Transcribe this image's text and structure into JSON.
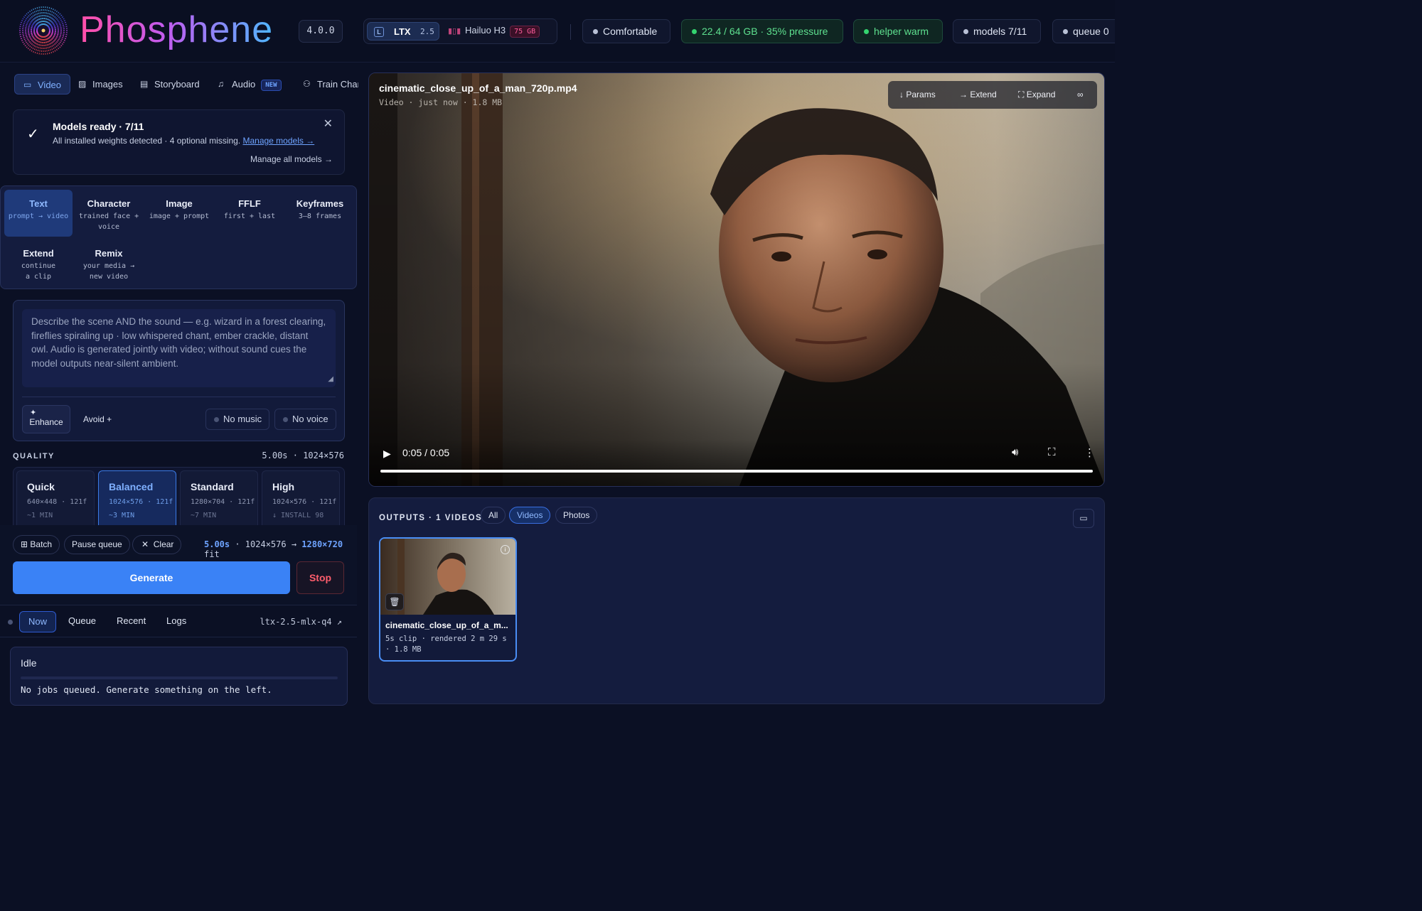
{
  "header": {
    "brand": "Phosphene",
    "version": "4.0.0",
    "engines": [
      {
        "name": "LTX",
        "version": "2.5",
        "active": true
      },
      {
        "name": "Hailuo H3",
        "badge": "75 GB",
        "active": false
      }
    ],
    "status_pills": [
      {
        "label": "Comfortable",
        "state": "neutral"
      },
      {
        "label": "22.4 / 64 GB · 35% pressure",
        "state": "ok"
      },
      {
        "label": "helper warm",
        "state": "ok"
      },
      {
        "label": "models 7/11",
        "state": "neutral"
      },
      {
        "label": "queue 0",
        "state": "neutral"
      }
    ]
  },
  "nav": {
    "tabs": [
      {
        "label": "Video",
        "icon": "video-icon",
        "active": true
      },
      {
        "label": "Images",
        "icon": "image-icon"
      },
      {
        "label": "Storyboard",
        "icon": "storyboard-icon"
      },
      {
        "label": "Audio",
        "icon": "music-note-icon",
        "badge": "NEW"
      },
      {
        "label": "Train Char",
        "icon": "user-icon"
      }
    ]
  },
  "notice": {
    "title": "Models ready · 7/11",
    "text": "All installed weights detected · 4 optional missing.",
    "link": "Manage models →",
    "footer_link": "Manage all models →"
  },
  "modes": [
    {
      "title": "Text",
      "sub": "prompt → video",
      "active": true
    },
    {
      "title": "Character",
      "sub": "trained face + voice"
    },
    {
      "title": "Image",
      "sub": "image + prompt"
    },
    {
      "title": "FFLF",
      "sub": "first + last"
    },
    {
      "title": "Keyframes",
      "sub": "3–8 frames"
    },
    {
      "title": "Extend",
      "sub": "continue a clip"
    },
    {
      "title": "Remix",
      "sub": "your media → new video"
    }
  ],
  "prompt": {
    "placeholder": "Describe the scene AND the sound — e.g. wizard in a forest clearing, fireflies spiraling up · low whispered chant, ember crackle, distant owl. Audio is generated jointly with video; without sound cues the model outputs near-silent ambient.",
    "enhance_label": "Enhance",
    "avoid_label": "Avoid +",
    "music_label": "No music",
    "voice_label": "No voice"
  },
  "quality": {
    "label": "QUALITY",
    "summary": "5.00s · 1024×576",
    "options": [
      {
        "name": "Quick",
        "spec": "640×448 · 121f",
        "time": "~1 MIN"
      },
      {
        "name": "Balanced",
        "spec": "1024×576 · 121f",
        "time": "~3 MIN",
        "active": true
      },
      {
        "name": "Standard",
        "spec": "1280×704 · 121f",
        "time": "~7 MIN"
      },
      {
        "name": "High",
        "spec": "1024×576 · 121f",
        "time": "↓ INSTALL 98"
      }
    ]
  },
  "actions": {
    "batch": "Batch",
    "pause": "Pause queue",
    "clear": "Clear",
    "duration": "5.00s",
    "res_from": " · 1024×576 → ",
    "res_to": "1280×720",
    "fit": " fit",
    "generate": "Generate",
    "stop": "Stop"
  },
  "bottom_tabs": {
    "tabs": [
      {
        "label": "Now",
        "active": true
      },
      {
        "label": "Queue"
      },
      {
        "label": "Recent"
      },
      {
        "label": "Logs"
      }
    ],
    "model_link": "ltx-2.5-mlx-q4 ↗"
  },
  "status_panel": {
    "title": "Idle",
    "message": "No jobs queued. Generate something on the left."
  },
  "player": {
    "filename": "cinematic_close_up_of_a_man_720p.mp4",
    "meta": "Video · just now · 1.8 MB",
    "toolbar": {
      "params": "Params",
      "extend": "Extend",
      "expand": "Expand"
    },
    "time": "0:05 / 0:05",
    "progress": 1.0
  },
  "outputs": {
    "label": "OUTPUTS · 1 VIDEOS",
    "filters": [
      {
        "label": "All"
      },
      {
        "label": "Videos",
        "active": true
      },
      {
        "label": "Photos"
      }
    ],
    "items": [
      {
        "title": "cinematic_close_up_of_a_m...",
        "meta": "5s clip · rendered 2 m 29 s · 1.8 MB"
      }
    ]
  },
  "colors": {
    "accent": "#3a82f6",
    "ok": "#34d46f",
    "danger": "#ff5d6c",
    "brand_pink": "#ff4fa8",
    "brand_blue": "#4fb6ff"
  }
}
